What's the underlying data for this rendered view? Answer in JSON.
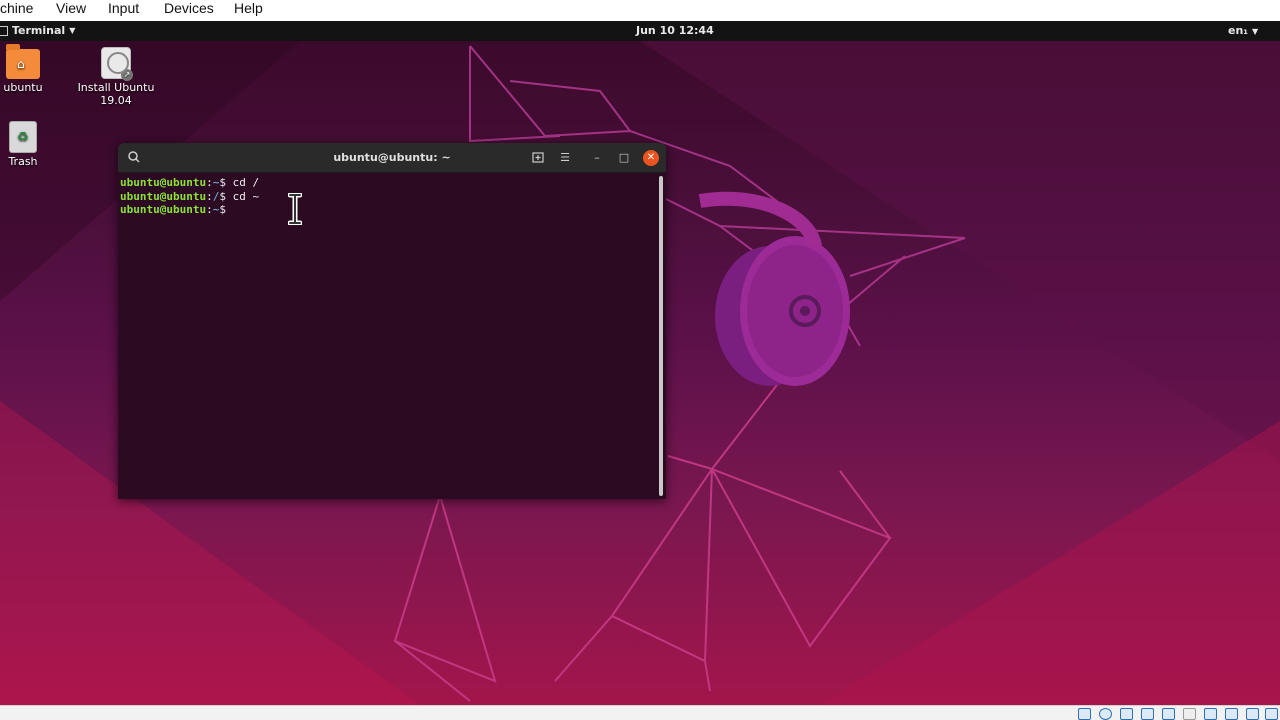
{
  "vbox_menu": {
    "items": [
      "chine",
      "View",
      "Input",
      "Devices",
      "Help"
    ]
  },
  "top_panel": {
    "app_menu": "Terminal",
    "clock": "Jun 10  12:44",
    "language": "en₁"
  },
  "desktop": {
    "icons": [
      {
        "label": "ubuntu",
        "icon": "home-folder-icon"
      },
      {
        "label": "Install Ubuntu 19.04",
        "icon": "install-disc-icon"
      },
      {
        "label": "Trash",
        "icon": "trash-icon"
      }
    ]
  },
  "terminal": {
    "title": "ubuntu@ubuntu: ~",
    "lines": [
      {
        "user": "ubuntu@ubuntu",
        "path": "~",
        "command": "cd /"
      },
      {
        "user": "ubuntu@ubuntu",
        "path": "/",
        "command": "cd ~"
      },
      {
        "user": "ubuntu@ubuntu",
        "path": "~",
        "command": ""
      }
    ]
  },
  "colors": {
    "accent": "#e95420",
    "prompt_user": "#8ae234",
    "prompt_path": "#729fcf",
    "terminal_bg": "#2c0a22"
  }
}
